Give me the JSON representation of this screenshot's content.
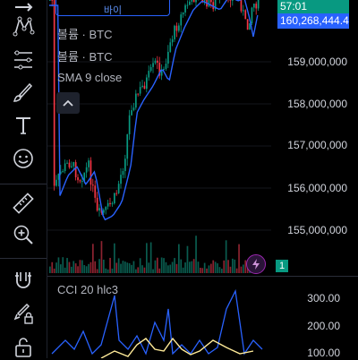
{
  "legend": {
    "volume_1": "볼륨 · BTC",
    "volume_2": "볼륨 · BTC",
    "sma_name": "SMA",
    "sma_params": "9 close",
    "cci_name": "CCI",
    "cci_params": "20 hlc3"
  },
  "buy_button_label": "바이",
  "badges": {
    "countdown": "57:01",
    "last_price": "160,268,444.4",
    "volume_pane": "1"
  },
  "price_axis": [
    "159,000,000",
    "158,000,000",
    "157,000,000",
    "156,000,000",
    "155,000,000"
  ],
  "cci_axis": [
    "300.00",
    "200.00",
    "100.00"
  ],
  "colors": {
    "up": "#089981",
    "down": "#f23645",
    "sma": "#2962ff",
    "cci_line": "#2962ff",
    "cci_signal": "#ffeb99",
    "accent": "#2962ff",
    "background": "#000000"
  },
  "toolbar_icons": [
    "line-tool-icon",
    "pattern-tool-icon",
    "fib-tool-icon",
    "brush-icon",
    "text-tool-icon",
    "emoji-icon",
    "ruler-icon",
    "zoom-in-icon",
    "magnet-icon",
    "lock-drawing-icon",
    "unlock-icon"
  ]
}
